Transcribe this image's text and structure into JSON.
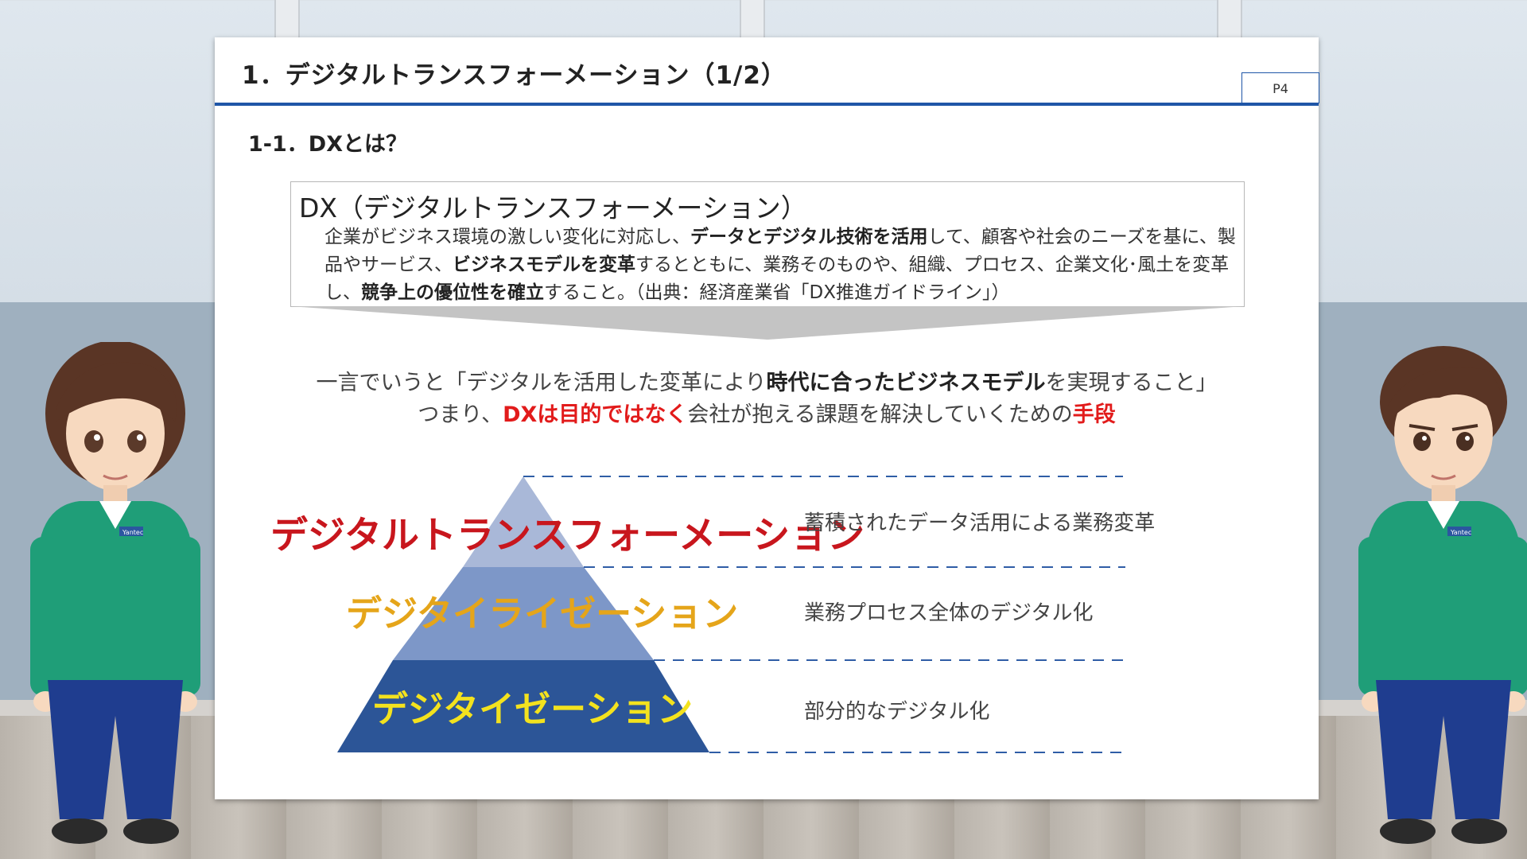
{
  "slide": {
    "title": "1．デジタルトランスフォーメーション（1/2）",
    "page_number": "P4",
    "subtitle": "1-1．DXとは？"
  },
  "definition": {
    "heading": "DX（デジタルトランスフォーメーション）",
    "parts": [
      {
        "text": "企業がビジネス環境の激しい変化に対応し、",
        "bold": false
      },
      {
        "text": "データとデジタル技術を活用",
        "bold": true
      },
      {
        "text": "して、顧客や社会のニーズを基に、製品やサービス、",
        "bold": false
      },
      {
        "text": "ビジネスモデルを変革",
        "bold": true
      },
      {
        "text": "するとともに、業務そのものや、組織、プロセス、企業文化･風土を変革し、",
        "bold": false
      },
      {
        "text": "競争上の優位性を確立",
        "bold": true
      },
      {
        "text": "すること。（出典：経済産業省「DX推進ガイドライン」）",
        "bold": false
      }
    ]
  },
  "summary": {
    "line1": [
      {
        "text": "一言でいうと「デジタルを活用した変革により",
        "style": "normal"
      },
      {
        "text": "時代に合ったビジネスモデル",
        "style": "bold"
      },
      {
        "text": "を実現すること」",
        "style": "normal"
      }
    ],
    "line2": [
      {
        "text": "つまり、",
        "style": "normal"
      },
      {
        "text": "DXは目的ではなく",
        "style": "red"
      },
      {
        "text": "会社が抱える課題を解決していくための",
        "style": "normal"
      },
      {
        "text": "手段",
        "style": "red"
      }
    ]
  },
  "pyramid": {
    "levels": [
      {
        "label": "デジタルトランスフォーメーション",
        "description": "蓄積されたデータ活用による業務変革"
      },
      {
        "label": "デジタイライゼーション",
        "description": "業務プロセス全体のデジタル化"
      },
      {
        "label": "デジタイゼーション",
        "description": "部分的なデジタル化"
      }
    ]
  },
  "characters": {
    "badge_text": "Yantec"
  }
}
